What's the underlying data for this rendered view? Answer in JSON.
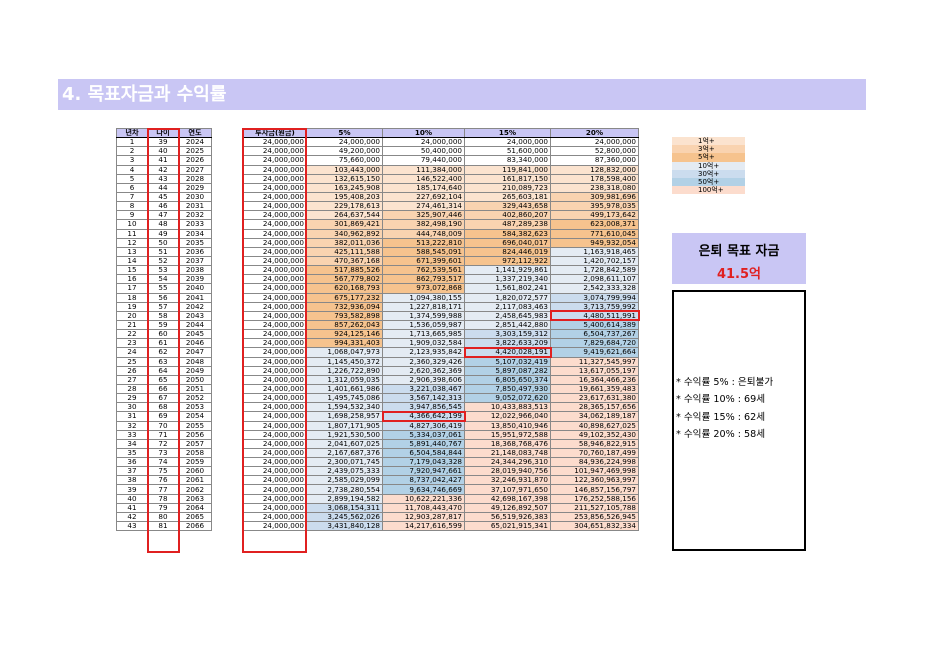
{
  "page_title": "4. 목표자금과 수익률",
  "left_headers": [
    "년차",
    "나이",
    "연도"
  ],
  "right_headers": [
    "투자금(원금)",
    "5%",
    "10%",
    "15%",
    "20%"
  ],
  "rows": [
    [
      "1",
      "39",
      "2024",
      "24,000,000",
      "24,000,000",
      "24,000,000",
      "24,000,000",
      "24,000,000"
    ],
    [
      "2",
      "40",
      "2025",
      "24,000,000",
      "49,200,000",
      "50,400,000",
      "51,600,000",
      "52,800,000"
    ],
    [
      "3",
      "41",
      "2026",
      "24,000,000",
      "75,660,000",
      "79,440,000",
      "83,340,000",
      "87,360,000"
    ],
    [
      "4",
      "42",
      "2027",
      "24,000,000",
      "103,443,000",
      "111,384,000",
      "119,841,000",
      "128,832,000"
    ],
    [
      "5",
      "43",
      "2028",
      "24,000,000",
      "132,615,150",
      "146,522,400",
      "161,817,150",
      "178,598,400"
    ],
    [
      "6",
      "44",
      "2029",
      "24,000,000",
      "163,245,908",
      "185,174,640",
      "210,089,723",
      "238,318,080"
    ],
    [
      "7",
      "45",
      "2030",
      "24,000,000",
      "195,408,203",
      "227,692,104",
      "265,603,181",
      "309,981,696"
    ],
    [
      "8",
      "46",
      "2031",
      "24,000,000",
      "229,178,613",
      "274,461,314",
      "329,443,658",
      "395,978,035"
    ],
    [
      "9",
      "47",
      "2032",
      "24,000,000",
      "264,637,544",
      "325,907,446",
      "402,860,207",
      "499,173,642"
    ],
    [
      "10",
      "48",
      "2033",
      "24,000,000",
      "301,869,421",
      "382,498,190",
      "487,289,238",
      "623,008,371"
    ],
    [
      "11",
      "49",
      "2034",
      "24,000,000",
      "340,962,892",
      "444,748,009",
      "584,382,623",
      "771,610,045"
    ],
    [
      "12",
      "50",
      "2035",
      "24,000,000",
      "382,011,036",
      "513,222,810",
      "696,040,017",
      "949,932,054"
    ],
    [
      "13",
      "51",
      "2036",
      "24,000,000",
      "425,111,588",
      "588,545,091",
      "824,446,019",
      "1,163,918,465"
    ],
    [
      "14",
      "52",
      "2037",
      "24,000,000",
      "470,367,168",
      "671,399,601",
      "972,112,922",
      "1,420,702,157"
    ],
    [
      "15",
      "53",
      "2038",
      "24,000,000",
      "517,885,526",
      "762,539,561",
      "1,141,929,861",
      "1,728,842,589"
    ],
    [
      "16",
      "54",
      "2039",
      "24,000,000",
      "567,779,802",
      "862,793,517",
      "1,337,219,340",
      "2,098,611,107"
    ],
    [
      "17",
      "55",
      "2040",
      "24,000,000",
      "620,168,793",
      "973,072,868",
      "1,561,802,241",
      "2,542,333,328"
    ],
    [
      "18",
      "56",
      "2041",
      "24,000,000",
      "675,177,232",
      "1,094,380,155",
      "1,820,072,577",
      "3,074,799,994"
    ],
    [
      "19",
      "57",
      "2042",
      "24,000,000",
      "732,936,094",
      "1,227,818,171",
      "2,117,083,463",
      "3,713,759,992"
    ],
    [
      "20",
      "58",
      "2043",
      "24,000,000",
      "793,582,898",
      "1,374,599,988",
      "2,458,645,983",
      "4,480,511,991"
    ],
    [
      "21",
      "59",
      "2044",
      "24,000,000",
      "857,262,043",
      "1,536,059,987",
      "2,851,442,880",
      "5,400,614,389"
    ],
    [
      "22",
      "60",
      "2045",
      "24,000,000",
      "924,125,146",
      "1,713,665,985",
      "3,303,159,312",
      "6,504,737,267"
    ],
    [
      "23",
      "61",
      "2046",
      "24,000,000",
      "994,331,403",
      "1,909,032,584",
      "3,822,633,209",
      "7,829,684,720"
    ],
    [
      "24",
      "62",
      "2047",
      "24,000,000",
      "1,068,047,973",
      "2,123,935,842",
      "4,420,028,191",
      "9,419,621,664"
    ],
    [
      "25",
      "63",
      "2048",
      "24,000,000",
      "1,145,450,372",
      "2,360,329,426",
      "5,107,032,419",
      "11,327,545,997"
    ],
    [
      "26",
      "64",
      "2049",
      "24,000,000",
      "1,226,722,890",
      "2,620,362,369",
      "5,897,087,282",
      "13,617,055,197"
    ],
    [
      "27",
      "65",
      "2050",
      "24,000,000",
      "1,312,059,035",
      "2,906,398,606",
      "6,805,650,374",
      "16,364,466,236"
    ],
    [
      "28",
      "66",
      "2051",
      "24,000,000",
      "1,401,661,986",
      "3,221,038,467",
      "7,850,497,930",
      "19,661,359,483"
    ],
    [
      "29",
      "67",
      "2052",
      "24,000,000",
      "1,495,745,086",
      "3,567,142,313",
      "9,052,072,620",
      "23,617,631,380"
    ],
    [
      "30",
      "68",
      "2053",
      "24,000,000",
      "1,594,532,340",
      "3,947,856,545",
      "10,433,883,513",
      "28,365,157,656"
    ],
    [
      "31",
      "69",
      "2054",
      "24,000,000",
      "1,698,258,957",
      "4,366,642,199",
      "12,022,966,040",
      "34,062,189,187"
    ],
    [
      "32",
      "70",
      "2055",
      "24,000,000",
      "1,807,171,905",
      "4,827,306,419",
      "13,850,410,946",
      "40,898,627,025"
    ],
    [
      "33",
      "71",
      "2056",
      "24,000,000",
      "1,921,530,500",
      "5,334,037,061",
      "15,951,972,588",
      "49,102,352,430"
    ],
    [
      "34",
      "72",
      "2057",
      "24,000,000",
      "2,041,607,025",
      "5,891,440,767",
      "18,368,768,476",
      "58,946,822,915"
    ],
    [
      "35",
      "73",
      "2058",
      "24,000,000",
      "2,167,687,376",
      "6,504,584,844",
      "21,148,083,748",
      "70,760,187,499"
    ],
    [
      "36",
      "74",
      "2059",
      "24,000,000",
      "2,300,071,745",
      "7,179,043,328",
      "24,344,296,310",
      "84,936,224,998"
    ],
    [
      "37",
      "75",
      "2060",
      "24,000,000",
      "2,439,075,333",
      "7,920,947,661",
      "28,019,940,756",
      "101,947,469,998"
    ],
    [
      "38",
      "76",
      "2061",
      "24,000,000",
      "2,585,029,099",
      "8,737,042,427",
      "32,246,931,870",
      "122,360,963,997"
    ],
    [
      "39",
      "77",
      "2062",
      "24,000,000",
      "2,738,280,554",
      "9,634,746,669",
      "37,107,971,650",
      "146,857,156,797"
    ],
    [
      "40",
      "78",
      "2063",
      "24,000,000",
      "2,899,194,582",
      "10,622,221,336",
      "42,698,167,398",
      "176,252,588,156"
    ],
    [
      "41",
      "79",
      "2064",
      "24,000,000",
      "3,068,154,311",
      "11,708,443,470",
      "49,126,892,507",
      "211,527,105,788"
    ],
    [
      "42",
      "80",
      "2065",
      "24,000,000",
      "3,245,562,026",
      "12,903,287,817",
      "56,519,926,383",
      "253,856,526,945"
    ],
    [
      "43",
      "81",
      "2066",
      "24,000,000",
      "3,431,840,128",
      "14,217,616,599",
      "65,021,915,341",
      "304,651,832,334"
    ]
  ],
  "colors": {
    "accent": "#c9c6f4",
    "red": "#e02020",
    "band_1억": "#fbe3cf",
    "band_3억": "#f9d3b0",
    "band_5억": "#f6c38e",
    "band_10억": "#e4ebf3",
    "band_30억": "#cbdcee",
    "band_50억": "#b2d1e6",
    "band_100억": "#fcdccd"
  },
  "legend": [
    {
      "label": "1억+",
      "color": "#fbe3cf"
    },
    {
      "label": "3억+",
      "color": "#f9d3b0"
    },
    {
      "label": "5억+",
      "color": "#f6c38e"
    },
    {
      "label": "10억+",
      "color": "#e4ebf3"
    },
    {
      "label": "30억+",
      "color": "#cbdcee"
    },
    {
      "label": "50억+",
      "color": "#b2d1e6"
    },
    {
      "label": "100억+",
      "color": "#fcdccd"
    }
  ],
  "retire": {
    "title": "은퇴 목표 자금",
    "value": "41.5억"
  },
  "notes": [
    "* 수익률 5% : 은퇴불가",
    "* 수익률 10% : 69세",
    "* 수익률 15% : 62세",
    "* 수익률 20% : 58세"
  ],
  "highlights": [
    {
      "row": 20,
      "col": 4
    },
    {
      "row": 24,
      "col": 3
    },
    {
      "row": 31,
      "col": 2
    }
  ]
}
